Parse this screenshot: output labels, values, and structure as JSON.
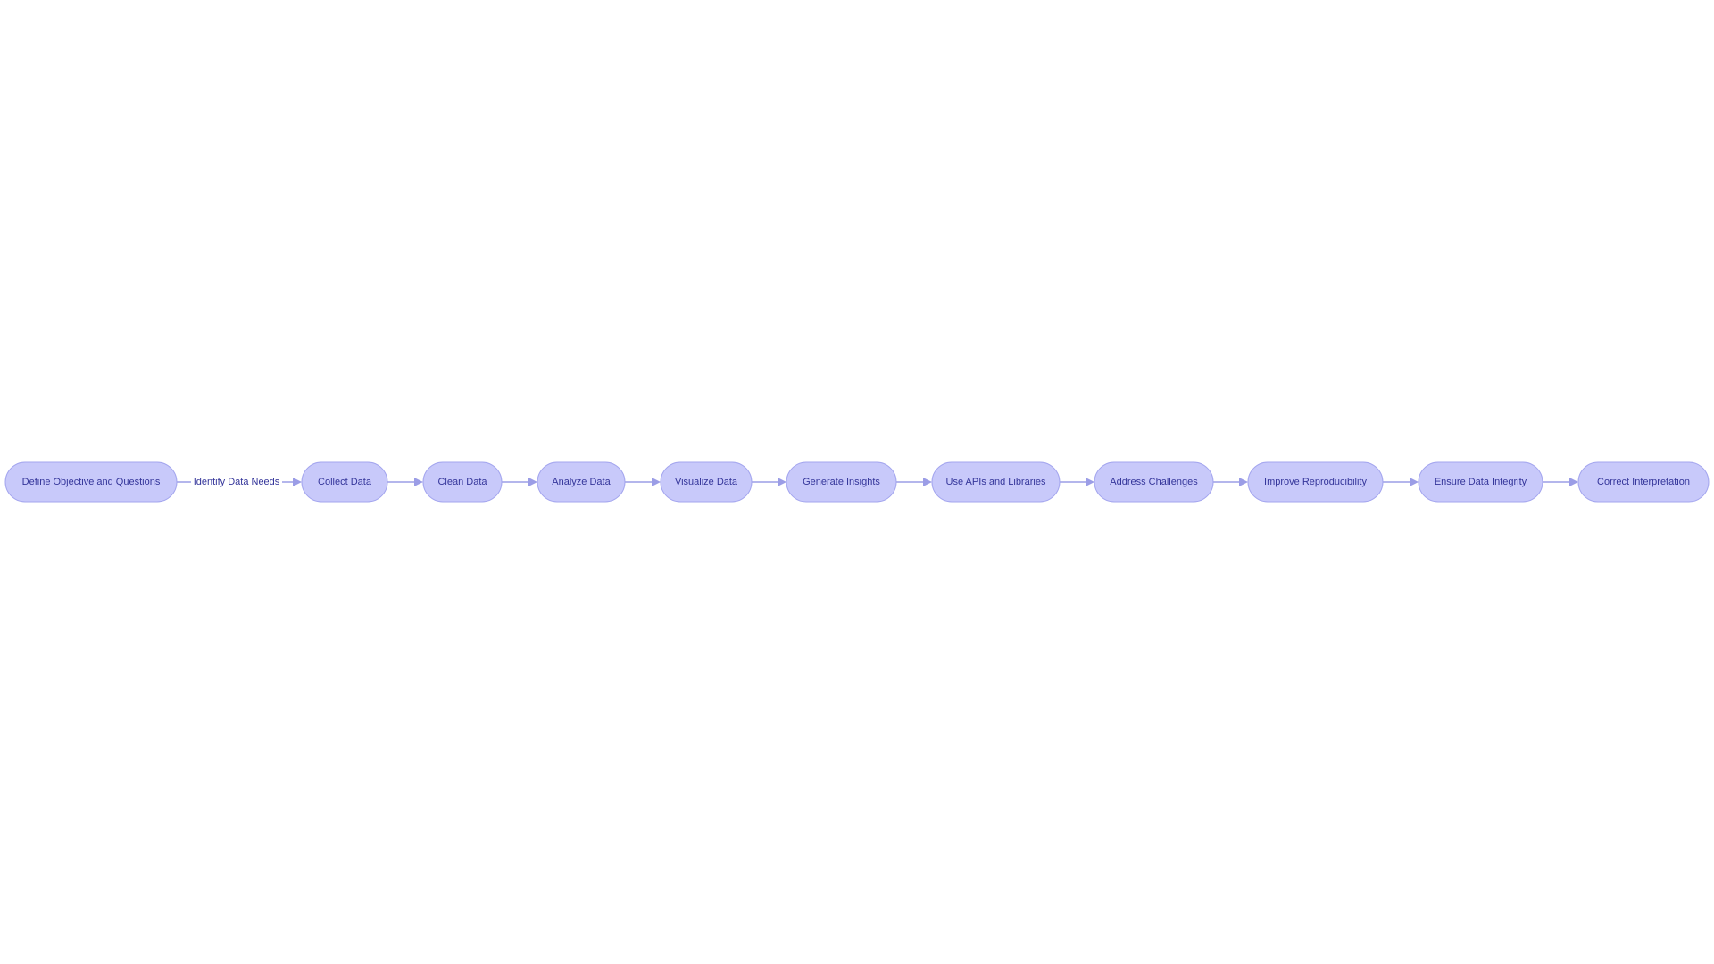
{
  "diagram": {
    "type": "flowchart",
    "direction": "left-to-right",
    "colors": {
      "node_fill": "#c8c9fa",
      "node_stroke": "#a3a5ee",
      "text": "#34359a",
      "edge": "#9b9de6"
    },
    "nodes": [
      {
        "id": "n1",
        "label": "Define Objective and Questions"
      },
      {
        "id": "n2",
        "label": "Collect Data"
      },
      {
        "id": "n3",
        "label": "Clean Data"
      },
      {
        "id": "n4",
        "label": "Analyze Data"
      },
      {
        "id": "n5",
        "label": "Visualize Data"
      },
      {
        "id": "n6",
        "label": "Generate Insights"
      },
      {
        "id": "n7",
        "label": "Use APIs and Libraries"
      },
      {
        "id": "n8",
        "label": "Address Challenges"
      },
      {
        "id": "n9",
        "label": "Improve Reproducibility"
      },
      {
        "id": "n10",
        "label": "Ensure Data Integrity"
      },
      {
        "id": "n11",
        "label": "Correct Interpretation"
      }
    ],
    "edges": [
      {
        "from": "n1",
        "to": "n2",
        "label": "Identify Data Needs"
      },
      {
        "from": "n2",
        "to": "n3",
        "label": ""
      },
      {
        "from": "n3",
        "to": "n4",
        "label": ""
      },
      {
        "from": "n4",
        "to": "n5",
        "label": ""
      },
      {
        "from": "n5",
        "to": "n6",
        "label": ""
      },
      {
        "from": "n6",
        "to": "n7",
        "label": ""
      },
      {
        "from": "n7",
        "to": "n8",
        "label": ""
      },
      {
        "from": "n8",
        "to": "n9",
        "label": ""
      },
      {
        "from": "n9",
        "to": "n10",
        "label": ""
      },
      {
        "from": "n10",
        "to": "n11",
        "label": ""
      }
    ]
  }
}
